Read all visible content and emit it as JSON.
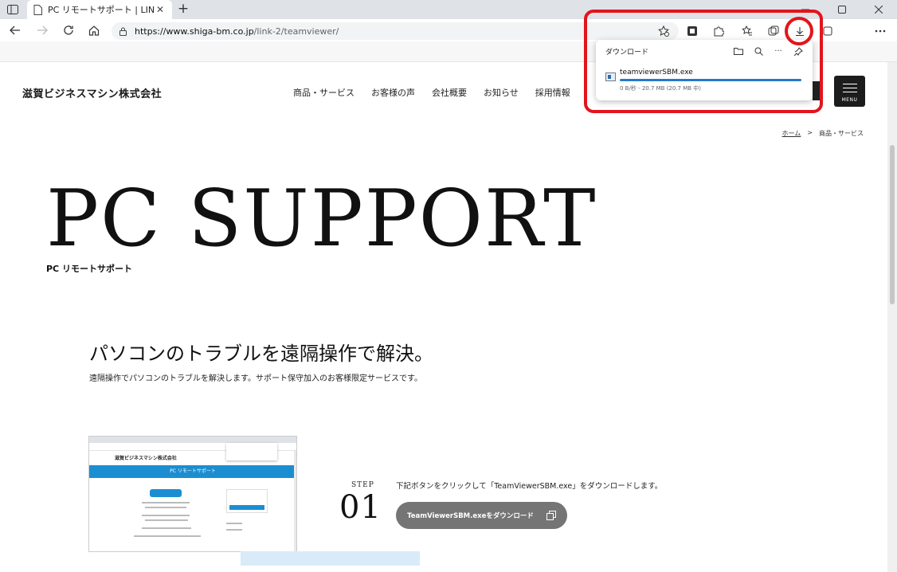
{
  "browser": {
    "tab": {
      "title": "PC リモートサポート | LINK | 滋賀ビジ",
      "close": "✕"
    },
    "new_tab": "+",
    "url": {
      "main": "https://www.shiga-bm.co.jp",
      "rest": "/link-2/teamviewer/"
    }
  },
  "downloads": {
    "header": "ダウンロード",
    "filename": "teamviewerSBM.exe",
    "status": "0 B/秒 - 20.7 MB (20.7 MB 中)",
    "progress": 0.02,
    "more": "···"
  },
  "site": {
    "logo": "滋賀ビジネスマシン株式会社",
    "nav": [
      "商品・サービス",
      "お客様の声",
      "会社概要",
      "お知らせ",
      "採用情報"
    ],
    "menu_label": "MENU",
    "breadcrumb": {
      "home": "ホーム",
      "sep": ">",
      "current": "商品・サービス"
    },
    "hero_title": "PC SUPPORT",
    "hero_sub": "PC リモートサポート",
    "section_title": "パソコンのトラブルを遠隔操作で解決。",
    "section_desc": "遠隔操作でパソコンのトラブルを解決します。サポート保守加入のお客様限定サービスです。",
    "step": {
      "label": "STEP",
      "number": "01",
      "text": "下記ボタンをクリックして「TeamViewerSBM.exe」をダウンロードします。",
      "button": "TeamViewerSBM.exeをダウンロード"
    },
    "thumb": {
      "logo": "滋賀ビジネスマシン株式会社",
      "banner": "PC リモートサポート"
    }
  },
  "colors": {
    "highlight": "#e3141b",
    "accent_blue": "#1a73c8",
    "button_gray": "#757575"
  }
}
